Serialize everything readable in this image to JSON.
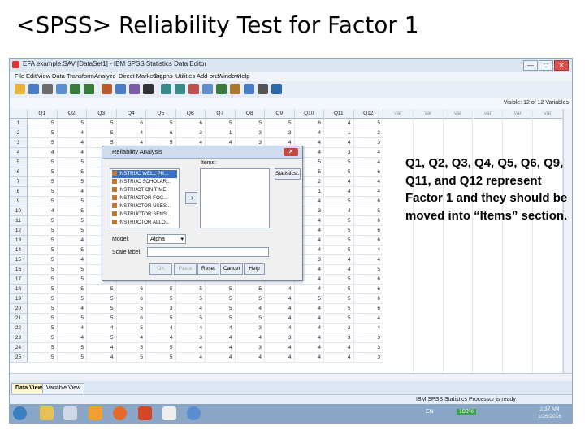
{
  "slide": {
    "title": "<SPSS> Reliability Test for Factor 1",
    "annotation": "Q1, Q2, Q3, Q4, Q5, Q6, Q9, Q11, and Q12 represent Factor 1 and they should be moved into “Items” section."
  },
  "window": {
    "title": "EFA example.SAV [DataSet1] - IBM SPSS Statistics Data Editor",
    "minimize": "—",
    "maximize": "□",
    "close": "✕"
  },
  "menu": [
    "File",
    "Edit",
    "View",
    "Data",
    "Transform",
    "Analyze",
    "Direct Marketing",
    "Graphs",
    "Utilities",
    "Add-ons",
    "Window",
    "Help"
  ],
  "visible_label": "Visible: 12 of 12 Variables",
  "grid": {
    "columns": [
      "Q1",
      "Q2",
      "Q3",
      "Q4",
      "Q5",
      "Q6",
      "Q7",
      "Q8",
      "Q9",
      "Q10",
      "Q11",
      "Q12"
    ],
    "empty_columns": [
      "var",
      "var",
      "var",
      "var",
      "var",
      "var"
    ],
    "rows": [
      [
        "5",
        "5",
        "5",
        "6",
        "5",
        "6",
        "5",
        "5",
        "5",
        "6",
        "4",
        "5"
      ],
      [
        "5",
        "4",
        "5",
        "4",
        "6",
        "3",
        "1",
        "3",
        "3",
        "4",
        "1",
        "2"
      ],
      [
        "5",
        "4",
        "5",
        "4",
        "5",
        "4",
        "4",
        "3",
        "4",
        "4",
        "4",
        "3"
      ],
      [
        "4",
        "4",
        "",
        "",
        "",
        "",
        "",
        "",
        "",
        "4",
        "3",
        "4"
      ],
      [
        "5",
        "5",
        "",
        "",
        "",
        "",
        "",
        "",
        "",
        "5",
        "5",
        "4"
      ],
      [
        "5",
        "5",
        "",
        "",
        "",
        "",
        "",
        "",
        "",
        "5",
        "5",
        "6"
      ],
      [
        "5",
        "5",
        "",
        "",
        "",
        "",
        "",
        "",
        "",
        "2",
        "4",
        "4"
      ],
      [
        "5",
        "4",
        "",
        "",
        "",
        "",
        "",
        "",
        "",
        "1",
        "4",
        "4"
      ],
      [
        "5",
        "5",
        "",
        "",
        "",
        "",
        "",
        "",
        "",
        "4",
        "5",
        "6"
      ],
      [
        "4",
        "5",
        "",
        "",
        "",
        "",
        "",
        "",
        "",
        "3",
        "4",
        "5"
      ],
      [
        "5",
        "5",
        "",
        "",
        "",
        "",
        "",
        "",
        "",
        "4",
        "5",
        "6"
      ],
      [
        "5",
        "5",
        "",
        "",
        "",
        "",
        "",
        "",
        "",
        "4",
        "5",
        "6"
      ],
      [
        "5",
        "4",
        "",
        "",
        "",
        "",
        "",
        "",
        "",
        "4",
        "5",
        "6"
      ],
      [
        "5",
        "5",
        "",
        "",
        "",
        "",
        "",
        "",
        "",
        "4",
        "5",
        "4"
      ],
      [
        "5",
        "4",
        "",
        "",
        "",
        "",
        "",
        "",
        "",
        "3",
        "4",
        "4"
      ],
      [
        "5",
        "5",
        "",
        "",
        "",
        "",
        "",
        "",
        "",
        "4",
        "4",
        "5"
      ],
      [
        "5",
        "5",
        "",
        "",
        "",
        "",
        "",
        "",
        "",
        "4",
        "5",
        "6"
      ],
      [
        "5",
        "5",
        "5",
        "6",
        "5",
        "5",
        "5",
        "5",
        "4",
        "4",
        "5",
        "6"
      ],
      [
        "5",
        "5",
        "5",
        "6",
        "5",
        "5",
        "5",
        "5",
        "4",
        "5",
        "5",
        "6"
      ],
      [
        "5",
        "4",
        "5",
        "5",
        "3",
        "4",
        "5",
        "4",
        "4",
        "4",
        "5",
        "6"
      ],
      [
        "5",
        "5",
        "5",
        "6",
        "5",
        "5",
        "5",
        "5",
        "4",
        "4",
        "5",
        "4"
      ],
      [
        "5",
        "4",
        "4",
        "5",
        "4",
        "4",
        "4",
        "3",
        "4",
        "4",
        "3",
        "4"
      ],
      [
        "5",
        "4",
        "5",
        "4",
        "4",
        "3",
        "4",
        "4",
        "3",
        "4",
        "3",
        "3"
      ],
      [
        "5",
        "5",
        "4",
        "5",
        "5",
        "4",
        "4",
        "3",
        "4",
        "4",
        "4",
        "3"
      ],
      [
        "5",
        "5",
        "4",
        "5",
        "5",
        "4",
        "4",
        "4",
        "4",
        "4",
        "4",
        "3"
      ]
    ]
  },
  "dialog": {
    "title": "Reliability Analysis",
    "close": "✕",
    "variables": [
      "INSTRUC WELL PR...",
      "INSTRUC SCHOLAR...",
      "INSTRUCT ON TIME",
      "INSTRUCTOR FOC...",
      "INSTRUCTOR USES...",
      "INSTRUCTOR SENS...",
      "INSTRUCTOR ALLO..."
    ],
    "move_arrow": "➔",
    "items_label": "Items:",
    "statistics_button": "Statistics...",
    "model_label": "Model:",
    "model_value": "Alpha",
    "scale_label": "Scale label:",
    "scale_value": "",
    "buttons": [
      "OK",
      "Paste",
      "Reset",
      "Cancel",
      "Help"
    ]
  },
  "tabs": {
    "data_view": "Data View",
    "variable_view": "Variable View"
  },
  "status": "IBM SPSS Statistics Processor is ready",
  "taskbar": {
    "lang": "EN",
    "battery": "100%",
    "time": "2:37 AM",
    "date": "1/26/2016"
  }
}
